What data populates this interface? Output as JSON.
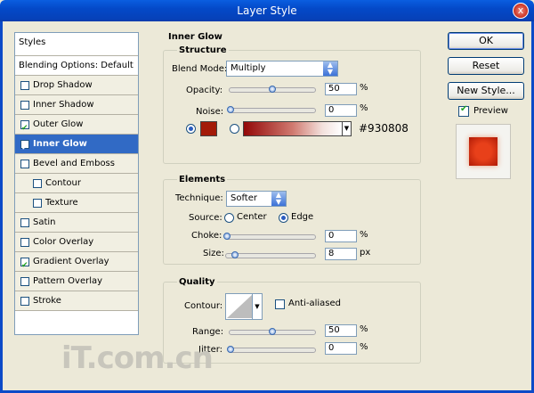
{
  "window": {
    "title": "Layer Style",
    "close_glyph": "x"
  },
  "styles_list": {
    "header": "Styles",
    "blending": "Blending Options: Default",
    "items": [
      {
        "label": "Drop Shadow",
        "checked": false,
        "indent": false,
        "selected": false
      },
      {
        "label": "Inner Shadow",
        "checked": false,
        "indent": false,
        "selected": false
      },
      {
        "label": "Outer Glow",
        "checked": true,
        "indent": false,
        "selected": false
      },
      {
        "label": "Inner Glow",
        "checked": true,
        "indent": false,
        "selected": true
      },
      {
        "label": "Bevel and Emboss",
        "checked": false,
        "indent": false,
        "selected": false
      },
      {
        "label": "Contour",
        "checked": false,
        "indent": true,
        "selected": false
      },
      {
        "label": "Texture",
        "checked": false,
        "indent": true,
        "selected": false
      },
      {
        "label": "Satin",
        "checked": false,
        "indent": false,
        "selected": false
      },
      {
        "label": "Color Overlay",
        "checked": false,
        "indent": false,
        "selected": false
      },
      {
        "label": "Gradient Overlay",
        "checked": true,
        "indent": false,
        "selected": false
      },
      {
        "label": "Pattern Overlay",
        "checked": false,
        "indent": false,
        "selected": false
      },
      {
        "label": "Stroke",
        "checked": false,
        "indent": false,
        "selected": false
      }
    ]
  },
  "inner_glow": {
    "title": "Inner Glow",
    "structure": {
      "title": "Structure",
      "blend_mode_label": "Blend Mode:",
      "blend_mode_value": "Multiply",
      "opacity_label": "Opacity:",
      "opacity_value": "50",
      "opacity_unit": "%",
      "opacity_level": 0.5,
      "noise_label": "Noise:",
      "noise_value": "0",
      "noise_unit": "%",
      "color_hex": "#930808",
      "swatch_color": "#a31a08"
    },
    "elements": {
      "title": "Elements",
      "technique_label": "Technique:",
      "technique_value": "Softer",
      "source_label": "Source:",
      "source_center": "Center",
      "source_edge": "Edge",
      "choke_label": "Choke:",
      "choke_value": "0",
      "choke_unit": "%",
      "size_label": "Size:",
      "size_value": "8",
      "size_unit": "px"
    },
    "quality": {
      "title": "Quality",
      "contour_label": "Contour:",
      "anti_aliased_label": "Anti-aliased",
      "range_label": "Range:",
      "range_value": "50",
      "range_unit": "%",
      "jitter_label": "Jitter:",
      "jitter_value": "0",
      "jitter_unit": "%"
    }
  },
  "buttons": {
    "ok": "OK",
    "reset": "Reset",
    "new_style": "New Style...",
    "preview": "Preview"
  },
  "watermark": "iT.com.cn"
}
